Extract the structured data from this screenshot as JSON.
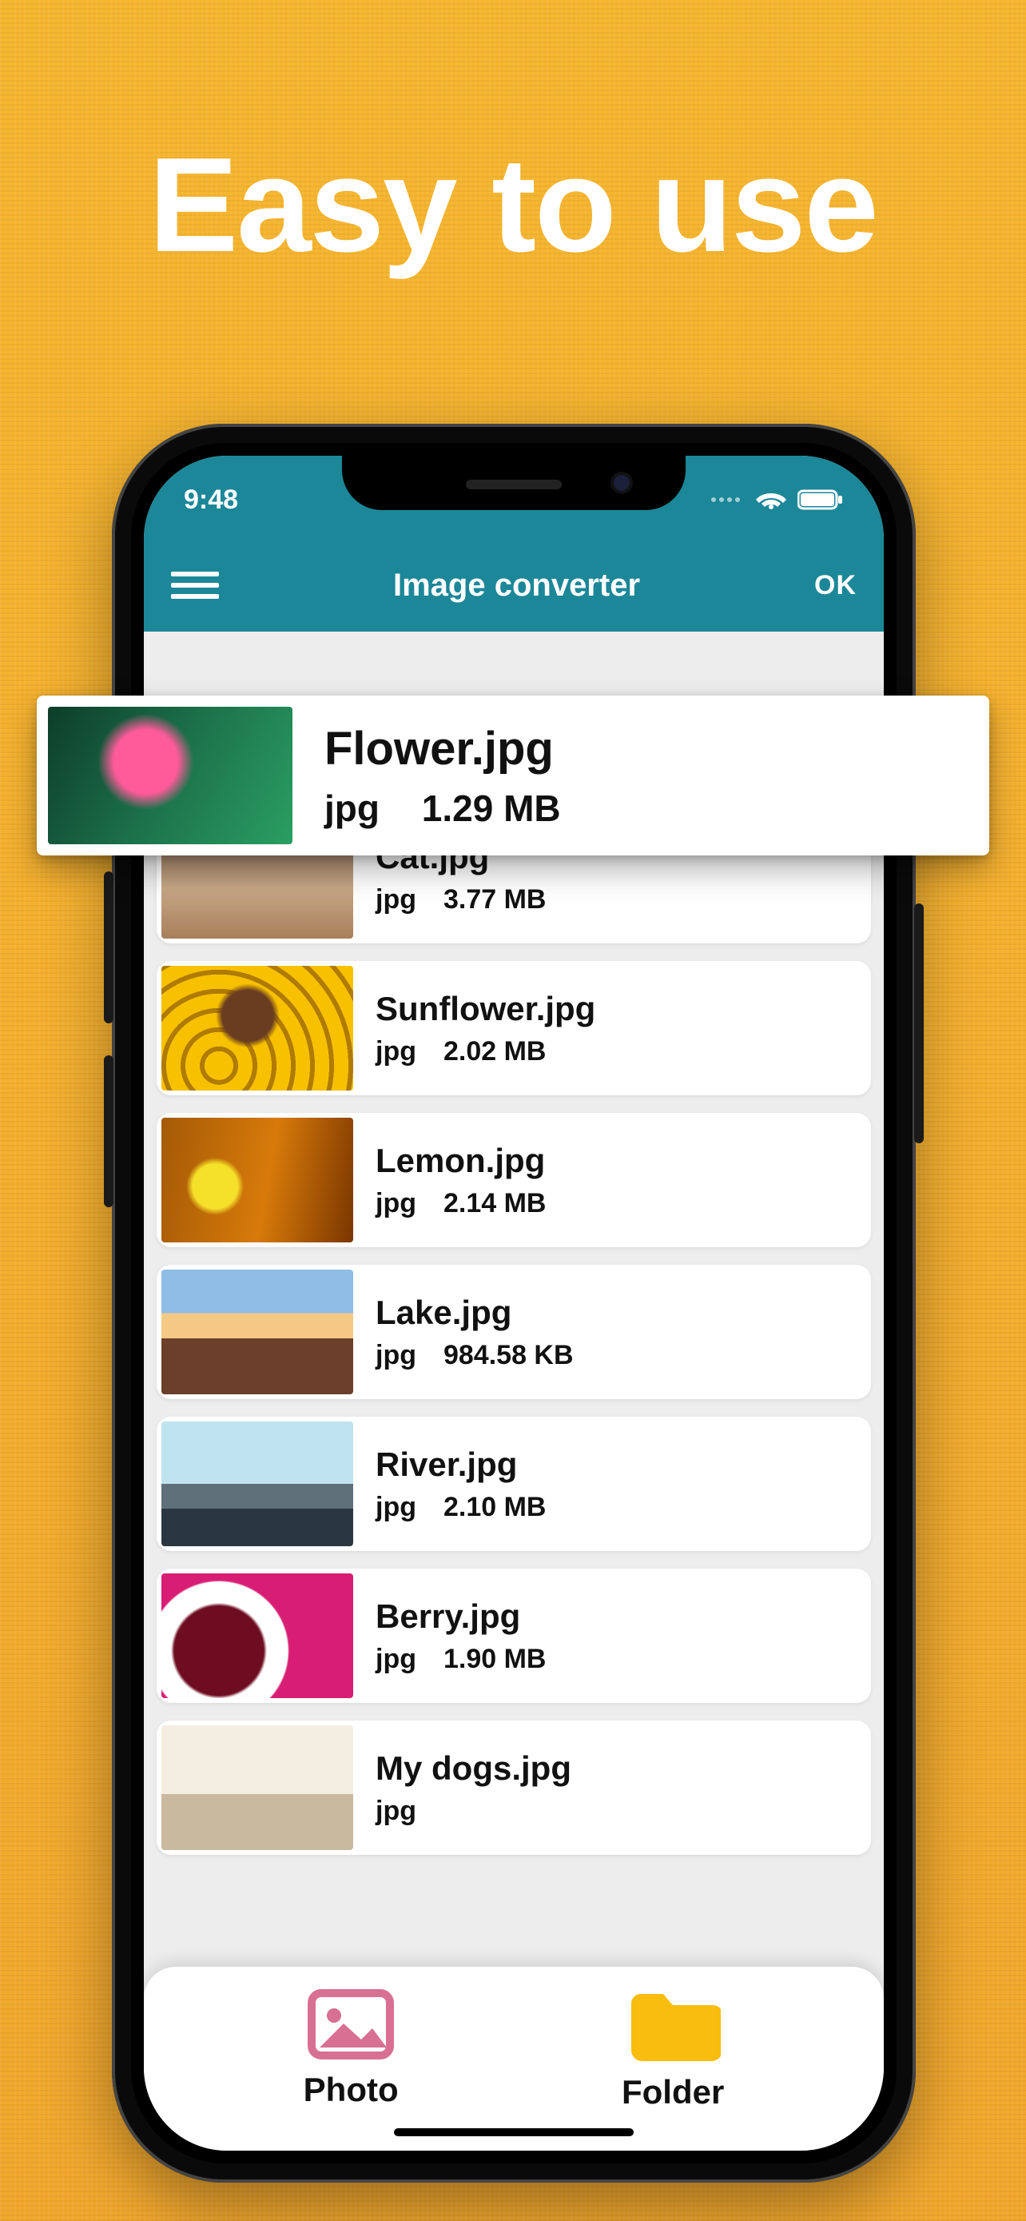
{
  "promo": {
    "headline": "Easy to use"
  },
  "status": {
    "time": "9:48"
  },
  "header": {
    "title": "Image converter",
    "ok_label": "OK"
  },
  "featured": {
    "name": "Flower.jpg",
    "ext": "jpg",
    "size": "1.29 MB"
  },
  "files": [
    {
      "name": "Cat.jpg",
      "ext": "jpg",
      "size": "3.77 MB",
      "thumb": "thumb-cat"
    },
    {
      "name": "Sunflower.jpg",
      "ext": "jpg",
      "size": "2.02 MB",
      "thumb": "thumb-sunflower"
    },
    {
      "name": "Lemon.jpg",
      "ext": "jpg",
      "size": "2.14 MB",
      "thumb": "thumb-lemon"
    },
    {
      "name": "Lake.jpg",
      "ext": "jpg",
      "size": "984.58 KB",
      "thumb": "thumb-lake"
    },
    {
      "name": "River.jpg",
      "ext": "jpg",
      "size": "2.10 MB",
      "thumb": "thumb-river"
    },
    {
      "name": "Berry.jpg",
      "ext": "jpg",
      "size": "1.90 MB",
      "thumb": "thumb-berry"
    },
    {
      "name": "My dogs.jpg",
      "ext": "jpg",
      "size": "",
      "thumb": "thumb-dogs"
    }
  ],
  "tabs": {
    "photo": "Photo",
    "folder": "Folder"
  },
  "colors": {
    "header_bg": "#1c8798",
    "accent_folder": "#f8bd0e",
    "accent_photo": "#d87093",
    "promo_bg": "#f4b131"
  }
}
